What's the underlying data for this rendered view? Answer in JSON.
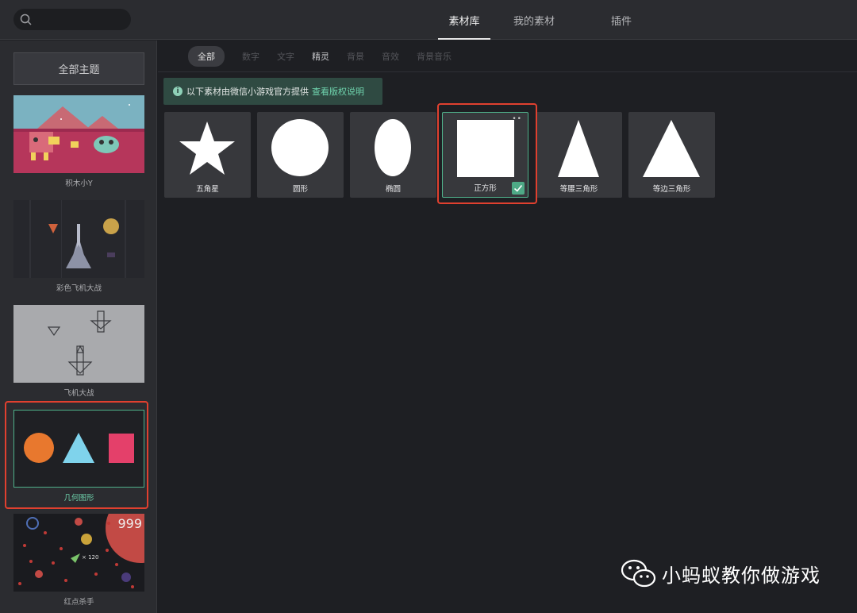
{
  "search": {
    "placeholder": ""
  },
  "tabs": [
    {
      "label": "素材库"
    },
    {
      "label": "我的素材"
    },
    {
      "label": "插件"
    }
  ],
  "sidebar": {
    "all_themes": "全部主题",
    "themes": [
      {
        "label": "积木小Y"
      },
      {
        "label": "彩色飞机大战"
      },
      {
        "label": "飞机大战"
      },
      {
        "label": "几何图形"
      },
      {
        "label": "红点杀手",
        "score": "999",
        "multiplier": "× 120"
      }
    ]
  },
  "filters": [
    {
      "label": "全部"
    },
    {
      "label": "数字"
    },
    {
      "label": "文字"
    },
    {
      "label": "精灵"
    },
    {
      "label": "背景"
    },
    {
      "label": "音效"
    },
    {
      "label": "背景音乐"
    }
  ],
  "notice": {
    "text": "以下素材由微信小游戏官方提供",
    "link": "查看版权说明"
  },
  "materials": [
    {
      "label": "五角星",
      "icon": "star-shape"
    },
    {
      "label": "圆形",
      "icon": "circle-shape"
    },
    {
      "label": "椭圆",
      "icon": "ellipse-shape"
    },
    {
      "label": "正方形",
      "icon": "square-shape",
      "selected": true
    },
    {
      "label": "等腰三角形",
      "icon": "isosceles-triangle-shape"
    },
    {
      "label": "等边三角形",
      "icon": "equilateral-triangle-shape"
    }
  ],
  "watermark": {
    "text": "小蚂蚁教你做游戏"
  },
  "colors": {
    "accent": "#4ea986",
    "highlight": "#e0402f",
    "orange": "#e8782e",
    "cyan": "#7fd3ec",
    "pink": "#e4406a"
  }
}
